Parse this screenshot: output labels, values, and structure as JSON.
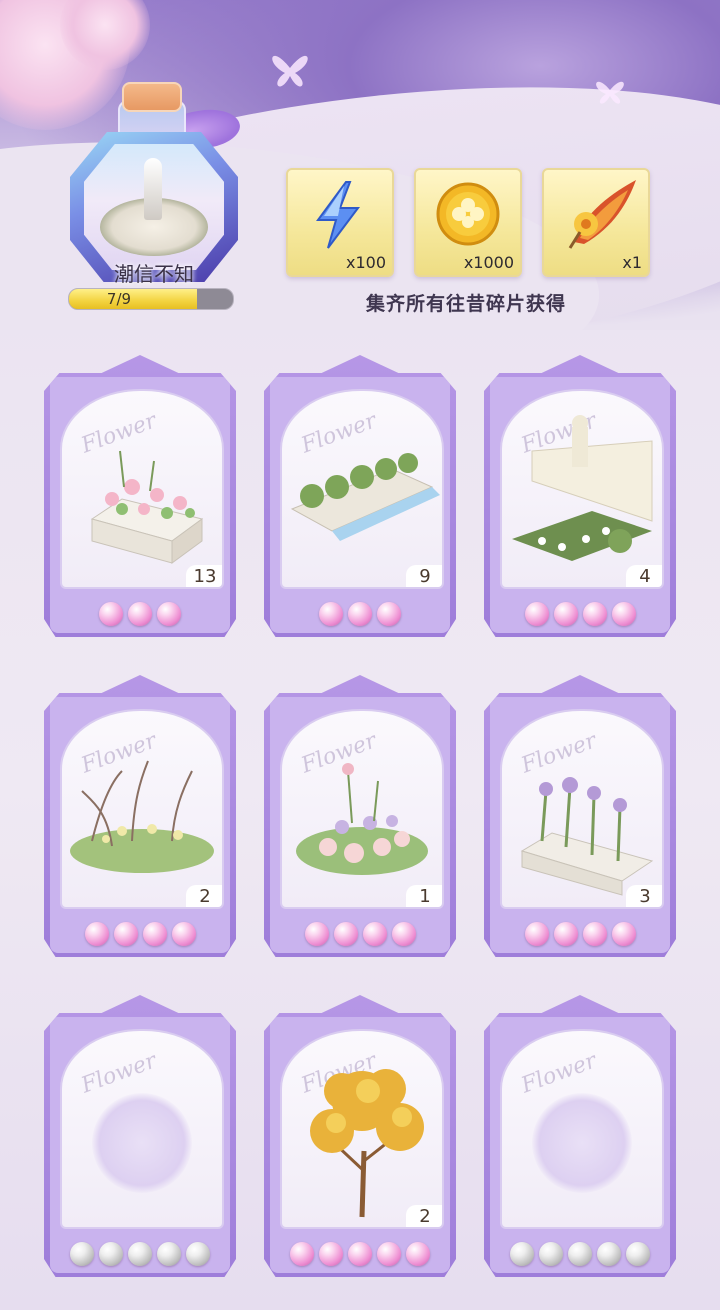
{
  "album": {
    "title": "潮信不知",
    "progress_text": "7/9",
    "progress_fraction": 0.78
  },
  "rewards": {
    "caption": "集齐所有往昔碎片获得",
    "items": [
      {
        "icon": "stamina-lightning-icon",
        "count": "x100"
      },
      {
        "icon": "gold-coin-icon",
        "count": "x1000"
      },
      {
        "icon": "flower-horn-item-icon",
        "count": "x1"
      }
    ]
  },
  "watermark": "Flower",
  "cards": [
    {
      "name": "planter-box-pink-flowers",
      "count": "13",
      "pearls": 3,
      "pearl_color": "pink"
    },
    {
      "name": "fountain-planter-row",
      "count": "9",
      "pearls": 3,
      "pearl_color": "pink"
    },
    {
      "name": "garden-wall-flowerbed",
      "count": "4",
      "pearls": 4,
      "pearl_color": "pink"
    },
    {
      "name": "wild-grass-bush",
      "count": "2",
      "pearls": 4,
      "pearl_color": "pink"
    },
    {
      "name": "mixed-flower-bush",
      "count": "1",
      "pearls": 4,
      "pearl_color": "pink"
    },
    {
      "name": "iris-planter",
      "count": "3",
      "pearls": 4,
      "pearl_color": "pink"
    },
    {
      "name": "locked-slot",
      "count": "",
      "pearls": 5,
      "pearl_color": "grey"
    },
    {
      "name": "golden-tree",
      "count": "2",
      "pearls": 5,
      "pearl_color": "pink"
    },
    {
      "name": "locked-slot",
      "count": "",
      "pearls": 5,
      "pearl_color": "grey"
    }
  ]
}
